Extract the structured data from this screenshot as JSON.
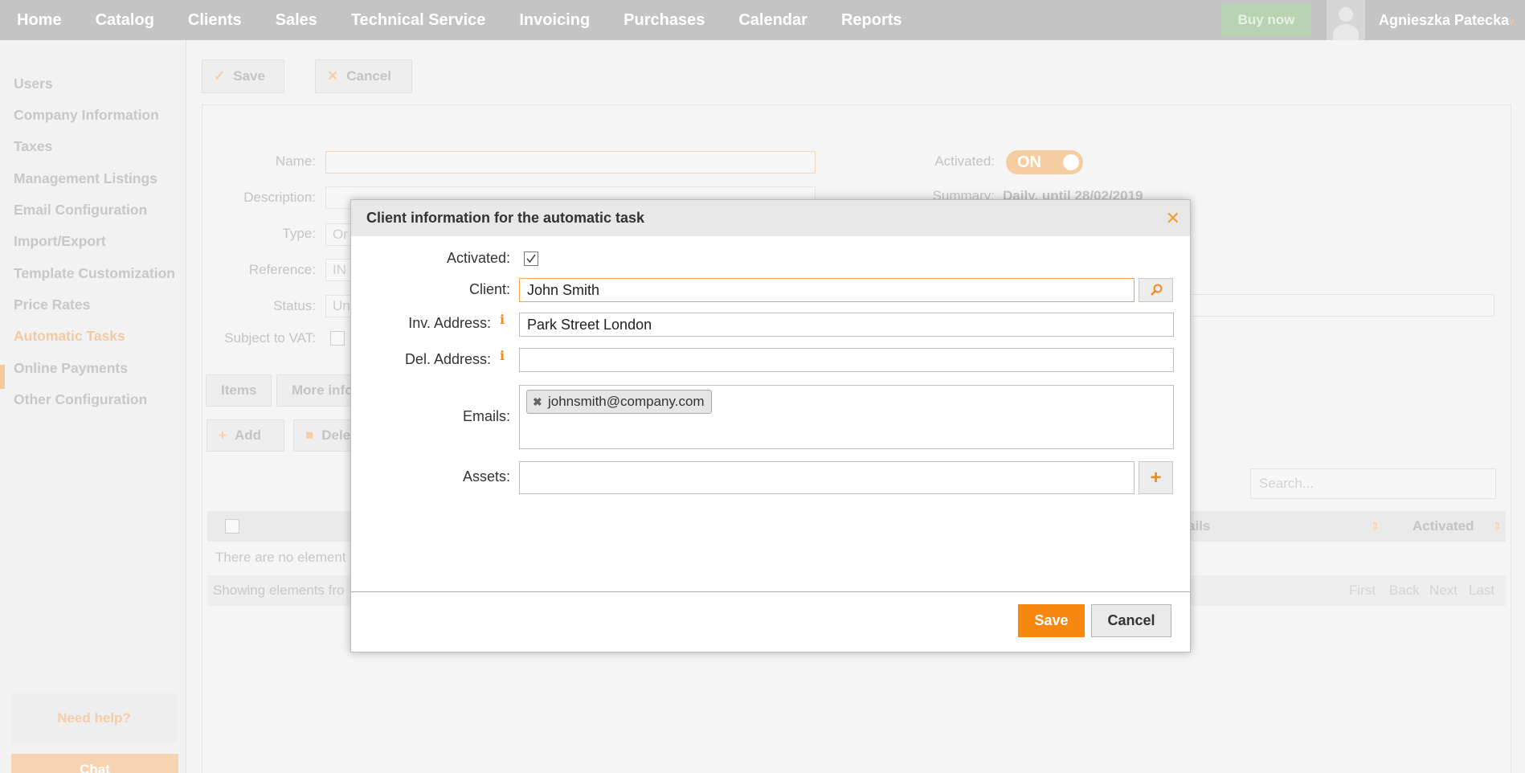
{
  "nav": {
    "items": [
      "Home",
      "Catalog",
      "Clients",
      "Sales",
      "Technical Service",
      "Invoicing",
      "Purchases",
      "Calendar",
      "Reports"
    ],
    "buy_now": "Buy now",
    "user_name": "Agnieszka Patecka"
  },
  "sidebar": {
    "items": [
      "Users",
      "Company Information",
      "Taxes",
      "Management Listings",
      "Email Configuration",
      "Import/Export",
      "Template Customization",
      "Price Rates",
      "Automatic Tasks",
      "Online Payments",
      "Other Configuration"
    ],
    "active": "Automatic Tasks",
    "help": "Need help?",
    "chat": "Chat"
  },
  "toolbar": {
    "save_label": "Save",
    "cancel_label": "Cancel"
  },
  "form": {
    "name_label": "Name:",
    "description_label": "Description:",
    "type_label": "Type:",
    "type_value": "Or",
    "reference_label": "Reference:",
    "reference_value": "IN",
    "status_label": "Status:",
    "status_value": "Un",
    "vat_label": "Subject to VAT:",
    "activated_label": "Activated:",
    "activated_toggle": "ON",
    "summary_label": "Summary:",
    "summary_value": "Daily, until 28/02/2019"
  },
  "tabs": [
    "Items",
    "More info"
  ],
  "list_toolbar": {
    "add_label": "Add",
    "delete_label": "Dele"
  },
  "table": {
    "search_placeholder": "Search...",
    "col_emails": "ails",
    "col_activated": "Activated",
    "empty_text": "There are no element",
    "footer_text": "Showing elements fro",
    "pager": [
      "First",
      "Back",
      "Next",
      "Last"
    ]
  },
  "modal": {
    "title": "Client information for the automatic task",
    "activated_label": "Activated:",
    "activated_checked": true,
    "client_label": "Client:",
    "client_value": "John Smith",
    "inv_address_label": "Inv. Address:",
    "inv_address_value": "Park Street London",
    "del_address_label": "Del. Address:",
    "del_address_value": "",
    "info_icon": "i",
    "emails_label": "Emails:",
    "emails": [
      "johnsmith@company.com"
    ],
    "assets_label": "Assets:",
    "assets_value": "",
    "save_label": "Save",
    "cancel_label": "Cancel"
  },
  "colors": {
    "accent": "#f7870f",
    "nav_bg": "#c4c4c4",
    "buy_now_bg": "#b7d3b2"
  }
}
